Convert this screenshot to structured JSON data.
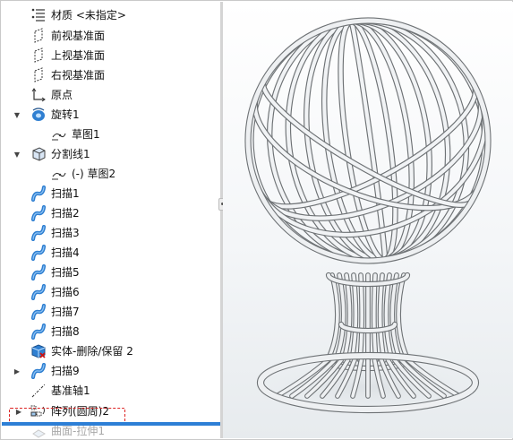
{
  "feature_tree": {
    "items": [
      {
        "label": "材质 <未指定>",
        "icon": "material-icon",
        "expander": ""
      },
      {
        "label": "前视基准面",
        "icon": "plane-icon",
        "expander": ""
      },
      {
        "label": "上视基准面",
        "icon": "plane-icon",
        "expander": ""
      },
      {
        "label": "右视基准面",
        "icon": "plane-icon",
        "expander": ""
      },
      {
        "label": "原点",
        "icon": "origin-icon",
        "expander": ""
      },
      {
        "label": "旋转1",
        "icon": "revolve-icon",
        "expander": "▼"
      },
      {
        "label": "草图1",
        "icon": "sketch-icon",
        "expander": ""
      },
      {
        "label": "分割线1",
        "icon": "split-line-icon",
        "expander": "▼"
      },
      {
        "label": "(-) 草图2",
        "icon": "sketch-icon",
        "expander": ""
      },
      {
        "label": "扫描1",
        "icon": "sweep-icon",
        "expander": ""
      },
      {
        "label": "扫描2",
        "icon": "sweep-icon",
        "expander": ""
      },
      {
        "label": "扫描3",
        "icon": "sweep-icon",
        "expander": ""
      },
      {
        "label": "扫描4",
        "icon": "sweep-icon",
        "expander": ""
      },
      {
        "label": "扫描5",
        "icon": "sweep-icon",
        "expander": ""
      },
      {
        "label": "扫描6",
        "icon": "sweep-icon",
        "expander": ""
      },
      {
        "label": "扫描7",
        "icon": "sweep-icon",
        "expander": ""
      },
      {
        "label": "扫描8",
        "icon": "sweep-icon",
        "expander": ""
      },
      {
        "label": "实体-删除/保留 2",
        "icon": "delete-body-icon",
        "expander": ""
      },
      {
        "label": "扫描9",
        "icon": "sweep-icon",
        "expander": "▶"
      },
      {
        "label": "基准轴1",
        "icon": "axis-icon",
        "expander": ""
      },
      {
        "label": "阵列(圆周)2",
        "icon": "circular-pattern-icon",
        "expander": "▶"
      },
      {
        "label": "曲面-拉伸1",
        "icon": "surface-extrude-icon",
        "expander": ""
      }
    ]
  },
  "colors": {
    "sweep_blue": "#2f7fd1",
    "highlight_dash": "#dd2222",
    "rollback_bar": "#2d7fd6"
  },
  "viewport": {
    "model": "wire-sphere-lamp"
  }
}
